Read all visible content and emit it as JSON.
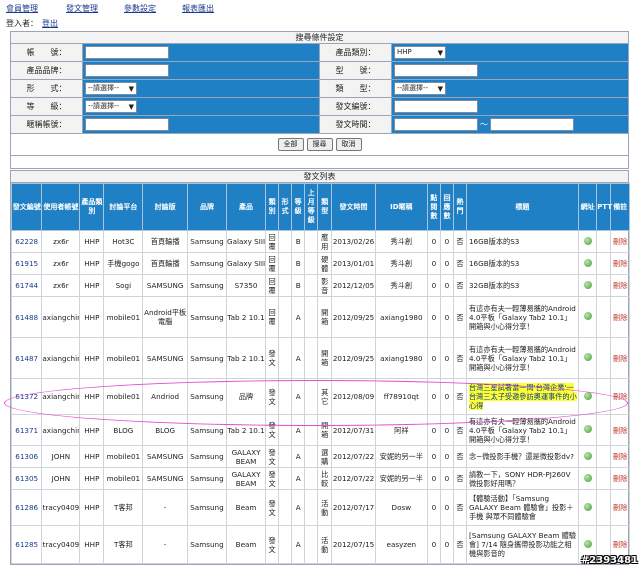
{
  "nav": {
    "items": [
      "會員管理",
      "發文管理",
      "參數設定",
      "報表匯出"
    ]
  },
  "login": {
    "label": "登入者：",
    "logout": "登出"
  },
  "search": {
    "title": "搜尋條件設定",
    "labels": {
      "account": "帳　　號：",
      "category": "產品類別：",
      "brand": "產品品牌：",
      "model": "型　　號：",
      "form": "形　　式：",
      "type": "類　　型：",
      "grade": "等　　級：",
      "post_id": "發文編號：",
      "alias": "暱稱帳號：",
      "post_time": "發文時間："
    },
    "values": {
      "category": "HHP",
      "form": "--請選擇--",
      "type": "--請選擇--",
      "grade": "--請選擇--",
      "date_sep": "～"
    },
    "buttons": {
      "all": "全部",
      "search": "搜尋",
      "cancel": "取消"
    }
  },
  "list": {
    "title": "發文列表",
    "headers": [
      "發文編號",
      "使用者帳號",
      "產品類別",
      "討論平台",
      "討論版",
      "品牌",
      "產品",
      "類別",
      "形式",
      "等級",
      "上月等級",
      "類型",
      "發文時間",
      "ID暱稱",
      "點閱數",
      "回應數",
      "熱門",
      "標題",
      "網址",
      "PTT",
      "備註"
    ],
    "rows": [
      {
        "id": "62228",
        "user": "zx6r",
        "cat": "HHP",
        "platform": "Hot3C",
        "board": "首頁輪播",
        "brand": "Samsung",
        "product": "Galaxy SIII",
        "kind": "回覆",
        "grade": "B",
        "last": "",
        "type": "應用",
        "time": "2013/02/26",
        "nick": "秀斗創",
        "views": "0",
        "replies": "0",
        "hot": "否",
        "title": "16GB版本的S3",
        "del": "刪除"
      },
      {
        "id": "61915",
        "user": "zx6r",
        "cat": "HHP",
        "platform": "手機gogo",
        "board": "首頁輪播",
        "brand": "Samsung",
        "product": "Galaxy SIII",
        "kind": "回覆",
        "grade": "B",
        "last": "",
        "type": "硬體",
        "time": "2013/01/01",
        "nick": "秀斗創",
        "views": "0",
        "replies": "0",
        "hot": "否",
        "title": "16GB版本的S3",
        "del": "刪除"
      },
      {
        "id": "61744",
        "user": "zx6r",
        "cat": "HHP",
        "platform": "Sogi",
        "board": "SAMSUNG",
        "brand": "Samsung",
        "product": "S7350",
        "kind": "回覆",
        "grade": "B",
        "last": "",
        "type": "影音",
        "time": "2012/12/05",
        "nick": "秀斗創",
        "views": "0",
        "replies": "0",
        "hot": "否",
        "title": "32GB版本的S3",
        "del": "刪除"
      },
      {
        "id": "61488",
        "user": "axiangchin",
        "cat": "HHP",
        "platform": "mobile01",
        "board": "Android平板電腦",
        "brand": "Samsung",
        "product": "Tab 2 10.1",
        "kind": "回覆",
        "grade": "A",
        "last": "",
        "type": "開箱",
        "time": "2012/09/25",
        "nick": "axiang1980",
        "views": "0",
        "replies": "0",
        "hot": "否",
        "title": "有這亦有夫一輕薄易攜的Android 4.0平板「Galaxy Tab2 10.1」開箱與小心得分享！",
        "del": "刪除"
      },
      {
        "id": "61487",
        "user": "axiangchin",
        "cat": "HHP",
        "platform": "mobile01",
        "board": "SAMSUNG",
        "brand": "Samsung",
        "product": "Tab 2 10.1",
        "kind": "發文",
        "grade": "A",
        "last": "",
        "type": "開箱",
        "time": "2012/09/25",
        "nick": "axiang1980",
        "views": "0",
        "replies": "0",
        "hot": "否",
        "title": "有這亦有夫一輕薄易攜的Android 4.0平板「Galaxy Tab2 10.1」開箱與小心得分享！",
        "del": "刪除"
      },
      {
        "id": "61372",
        "user": "axiangchin",
        "cat": "HHP",
        "platform": "mobile01",
        "board": "Andriod",
        "brand": "Samsung",
        "product": "品牌",
        "kind": "發文",
        "grade": "A",
        "last": "",
        "type": "其它",
        "time": "2012/08/09",
        "nick": "ff78910qt",
        "views": "0",
        "replies": "0",
        "hot": "否",
        "title": "台灣三星試著當一間'台灣企業'一台灣三太子受邀參訪奧運事件的小心得",
        "highlight": true,
        "del": "刪除"
      },
      {
        "id": "61371",
        "user": "axiangchin",
        "cat": "HHP",
        "platform": "BLOG",
        "board": "BLOG",
        "brand": "Samsung",
        "product": "Tab 2 10.1",
        "kind": "發文",
        "grade": "A",
        "last": "",
        "type": "開箱",
        "time": "2012/07/31",
        "nick": "阿祥",
        "views": "0",
        "replies": "0",
        "hot": "否",
        "title": "有這亦有夫一輕薄易攜的Android 4.0平板「Galaxy Tab2 10.1」開箱與小心得分享！",
        "del": "刪除"
      },
      {
        "id": "61306",
        "user": "JOHN",
        "cat": "HHP",
        "platform": "mobile01",
        "board": "SAMSUNG",
        "brand": "Samsung",
        "product": "GALAXY BEAM",
        "kind": "發文",
        "grade": "A",
        "last": "",
        "type": "選購",
        "time": "2012/07/22",
        "nick": "安妮的另一半",
        "views": "0",
        "replies": "0",
        "hot": "否",
        "title": "念~微投影手機？還是微投影dv?",
        "del": "刪除"
      },
      {
        "id": "61305",
        "user": "JOHN",
        "cat": "HHP",
        "platform": "mobile01",
        "board": "SAMSUNG",
        "brand": "Samsung",
        "product": "GALAXY BEAM",
        "kind": "發文",
        "grade": "A",
        "last": "",
        "type": "比較",
        "time": "2012/07/22",
        "nick": "安妮的另一半",
        "views": "0",
        "replies": "0",
        "hot": "否",
        "title": "請教一下，SONY HDR-PJ260V 微投影好用嗎？",
        "del": "刪除"
      },
      {
        "id": "61286",
        "user": "tracy0409",
        "cat": "HHP",
        "platform": "T客邦",
        "board": "-",
        "brand": "Samsung",
        "product": "Beam",
        "kind": "發文",
        "grade": "A",
        "last": "",
        "type": "活動",
        "time": "2012/07/17",
        "nick": "Dosw",
        "views": "0",
        "replies": "0",
        "hot": "否",
        "title": "【體驗活動】「Samsung GALAXY Beam 體驗會」投影＋手機 與眾不同體驗會",
        "del": "刪除"
      },
      {
        "id": "61285",
        "user": "tracy0409",
        "cat": "HHP",
        "platform": "T客邦",
        "board": "-",
        "brand": "Samsung",
        "product": "Beam",
        "kind": "發文",
        "grade": "A",
        "last": "",
        "type": "活動",
        "time": "2012/07/15",
        "nick": "easyzen",
        "views": "0",
        "replies": "0",
        "hot": "否",
        "title": "[Samsung GALAXY Beam 體驗會] 7/14 隨身攜帶投影功能之相機與影音的",
        "del": "刪除"
      }
    ]
  },
  "watermark": "#2393481"
}
